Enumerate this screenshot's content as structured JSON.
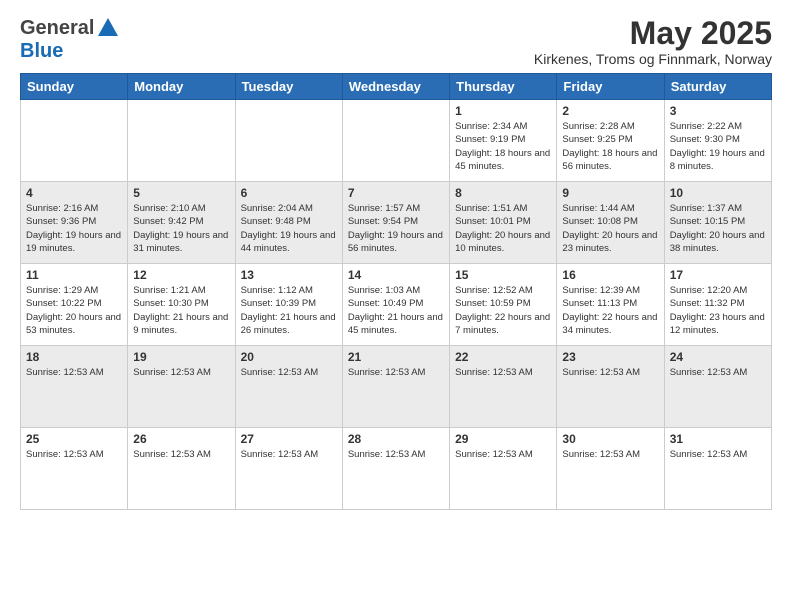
{
  "header": {
    "logo_general": "General",
    "logo_blue": "Blue",
    "month_year": "May 2025",
    "location": "Kirkenes, Troms og Finnmark, Norway"
  },
  "days_of_week": [
    "Sunday",
    "Monday",
    "Tuesday",
    "Wednesday",
    "Thursday",
    "Friday",
    "Saturday"
  ],
  "weeks": [
    {
      "alt": false,
      "days": [
        {
          "num": "",
          "info": ""
        },
        {
          "num": "",
          "info": ""
        },
        {
          "num": "",
          "info": ""
        },
        {
          "num": "",
          "info": ""
        },
        {
          "num": "1",
          "info": "Sunrise: 2:34 AM\nSunset: 9:19 PM\nDaylight: 18 hours and 45 minutes."
        },
        {
          "num": "2",
          "info": "Sunrise: 2:28 AM\nSunset: 9:25 PM\nDaylight: 18 hours and 56 minutes."
        },
        {
          "num": "3",
          "info": "Sunrise: 2:22 AM\nSunset: 9:30 PM\nDaylight: 19 hours and 8 minutes."
        }
      ]
    },
    {
      "alt": true,
      "days": [
        {
          "num": "4",
          "info": "Sunrise: 2:16 AM\nSunset: 9:36 PM\nDaylight: 19 hours and 19 minutes."
        },
        {
          "num": "5",
          "info": "Sunrise: 2:10 AM\nSunset: 9:42 PM\nDaylight: 19 hours and 31 minutes."
        },
        {
          "num": "6",
          "info": "Sunrise: 2:04 AM\nSunset: 9:48 PM\nDaylight: 19 hours and 44 minutes."
        },
        {
          "num": "7",
          "info": "Sunrise: 1:57 AM\nSunset: 9:54 PM\nDaylight: 19 hours and 56 minutes."
        },
        {
          "num": "8",
          "info": "Sunrise: 1:51 AM\nSunset: 10:01 PM\nDaylight: 20 hours and 10 minutes."
        },
        {
          "num": "9",
          "info": "Sunrise: 1:44 AM\nSunset: 10:08 PM\nDaylight: 20 hours and 23 minutes."
        },
        {
          "num": "10",
          "info": "Sunrise: 1:37 AM\nSunset: 10:15 PM\nDaylight: 20 hours and 38 minutes."
        }
      ]
    },
    {
      "alt": false,
      "days": [
        {
          "num": "11",
          "info": "Sunrise: 1:29 AM\nSunset: 10:22 PM\nDaylight: 20 hours and 53 minutes."
        },
        {
          "num": "12",
          "info": "Sunrise: 1:21 AM\nSunset: 10:30 PM\nDaylight: 21 hours and 9 minutes."
        },
        {
          "num": "13",
          "info": "Sunrise: 1:12 AM\nSunset: 10:39 PM\nDaylight: 21 hours and 26 minutes."
        },
        {
          "num": "14",
          "info": "Sunrise: 1:03 AM\nSunset: 10:49 PM\nDaylight: 21 hours and 45 minutes."
        },
        {
          "num": "15",
          "info": "Sunrise: 12:52 AM\nSunset: 10:59 PM\nDaylight: 22 hours and 7 minutes."
        },
        {
          "num": "16",
          "info": "Sunrise: 12:39 AM\nSunset: 11:13 PM\nDaylight: 22 hours and 34 minutes."
        },
        {
          "num": "17",
          "info": "Sunrise: 12:20 AM\nSunset: 11:32 PM\nDaylight: 23 hours and 12 minutes."
        }
      ]
    },
    {
      "alt": true,
      "days": [
        {
          "num": "18",
          "info": "Sunrise: 12:53 AM"
        },
        {
          "num": "19",
          "info": "Sunrise: 12:53 AM"
        },
        {
          "num": "20",
          "info": "Sunrise: 12:53 AM"
        },
        {
          "num": "21",
          "info": "Sunrise: 12:53 AM"
        },
        {
          "num": "22",
          "info": "Sunrise: 12:53 AM"
        },
        {
          "num": "23",
          "info": "Sunrise: 12:53 AM"
        },
        {
          "num": "24",
          "info": "Sunrise: 12:53 AM"
        }
      ]
    },
    {
      "alt": false,
      "days": [
        {
          "num": "25",
          "info": "Sunrise: 12:53 AM"
        },
        {
          "num": "26",
          "info": "Sunrise: 12:53 AM"
        },
        {
          "num": "27",
          "info": "Sunrise: 12:53 AM"
        },
        {
          "num": "28",
          "info": "Sunrise: 12:53 AM"
        },
        {
          "num": "29",
          "info": "Sunrise: 12:53 AM"
        },
        {
          "num": "30",
          "info": "Sunrise: 12:53 AM"
        },
        {
          "num": "31",
          "info": "Sunrise: 12:53 AM"
        }
      ]
    }
  ]
}
